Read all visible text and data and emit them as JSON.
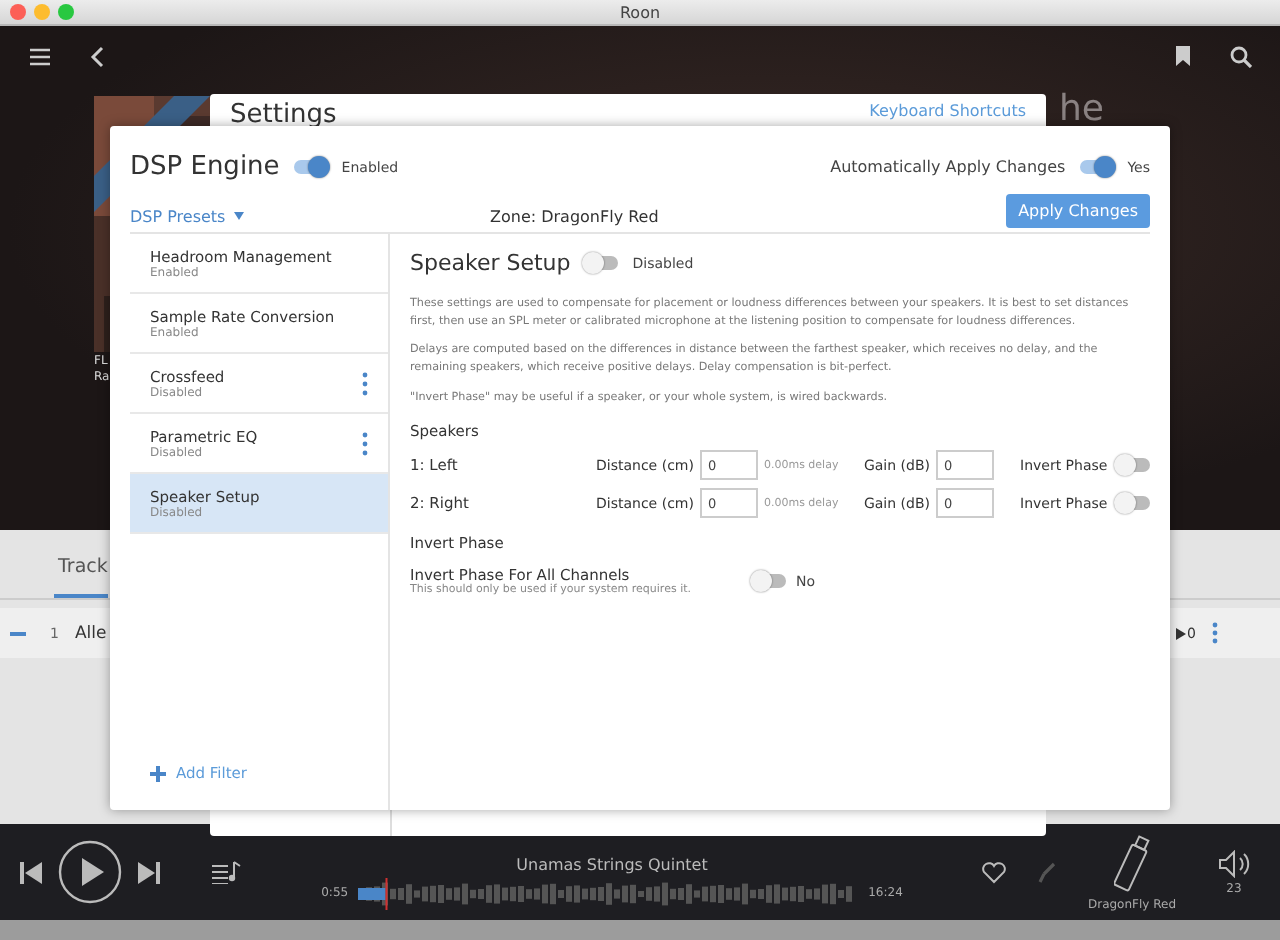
{
  "window": {
    "title": "Roon"
  },
  "background": {
    "album_texts": [
      "FL",
      "Ra"
    ],
    "title_fragment": "he",
    "tab": {
      "label": "Track",
      "selected": true
    },
    "track": {
      "number": "1",
      "title": "Alle",
      "plays": "0"
    }
  },
  "settings": {
    "title": "Settings",
    "link": "Keyboard Shortcuts"
  },
  "dsp": {
    "title": "DSP Engine",
    "enabled": {
      "on": true,
      "label": "Enabled"
    },
    "auto_apply": {
      "label": "Automatically Apply Changes",
      "on": true,
      "value": "Yes"
    },
    "presets": "DSP Presets",
    "zone": "Zone: DragonFly Red",
    "apply": "Apply Changes",
    "filters": [
      {
        "name": "Headroom Management",
        "status": "Enabled",
        "selected": false,
        "menu": false
      },
      {
        "name": "Sample Rate Conversion",
        "status": "Enabled",
        "selected": false,
        "menu": false
      },
      {
        "name": "Crossfeed",
        "status": "Disabled",
        "selected": false,
        "menu": true
      },
      {
        "name": "Parametric EQ",
        "status": "Disabled",
        "selected": false,
        "menu": true
      },
      {
        "name": "Speaker Setup",
        "status": "Disabled",
        "selected": true,
        "menu": false
      }
    ],
    "add_filter": "Add Filter",
    "panel": {
      "title": "Speaker Setup",
      "on": false,
      "status": "Disabled",
      "paragraphs": [
        "These settings are used to compensate for placement or loudness differences between your speakers. It is best to set distances first, then use an SPL meter or calibrated microphone at the listening position to compensate for loudness differences.",
        "Delays are computed based on the differences in distance between the farthest speaker, which receives no delay, and the remaining speakers, which receive positive delays. Delay compensation is bit-perfect.",
        "\"Invert Phase\" may be useful if a speaker, or your whole system, is wired backwards."
      ],
      "speakers_heading": "Speakers",
      "speakers": [
        {
          "name": "1: Left",
          "distance_label": "Distance (cm)",
          "distance": "0",
          "delay": "0.00ms delay",
          "gain_label": "Gain (dB)",
          "gain": "0",
          "invert_label": "Invert Phase",
          "invert": false
        },
        {
          "name": "2: Right",
          "distance_label": "Distance (cm)",
          "distance": "0",
          "delay": "0.00ms delay",
          "gain_label": "Gain (dB)",
          "gain": "0",
          "invert_label": "Invert Phase",
          "invert": false
        }
      ],
      "invert_heading": "Invert Phase",
      "invert_all": {
        "label": "Invert Phase For All Channels",
        "hint": "This should only be used if your system requires it.",
        "on": false,
        "value": "No"
      }
    }
  },
  "player": {
    "artist": "Unamas Strings Quintet",
    "elapsed": "0:55",
    "duration": "16:24",
    "level": 0.055,
    "zone": "DragonFly Red",
    "volume": "23"
  }
}
